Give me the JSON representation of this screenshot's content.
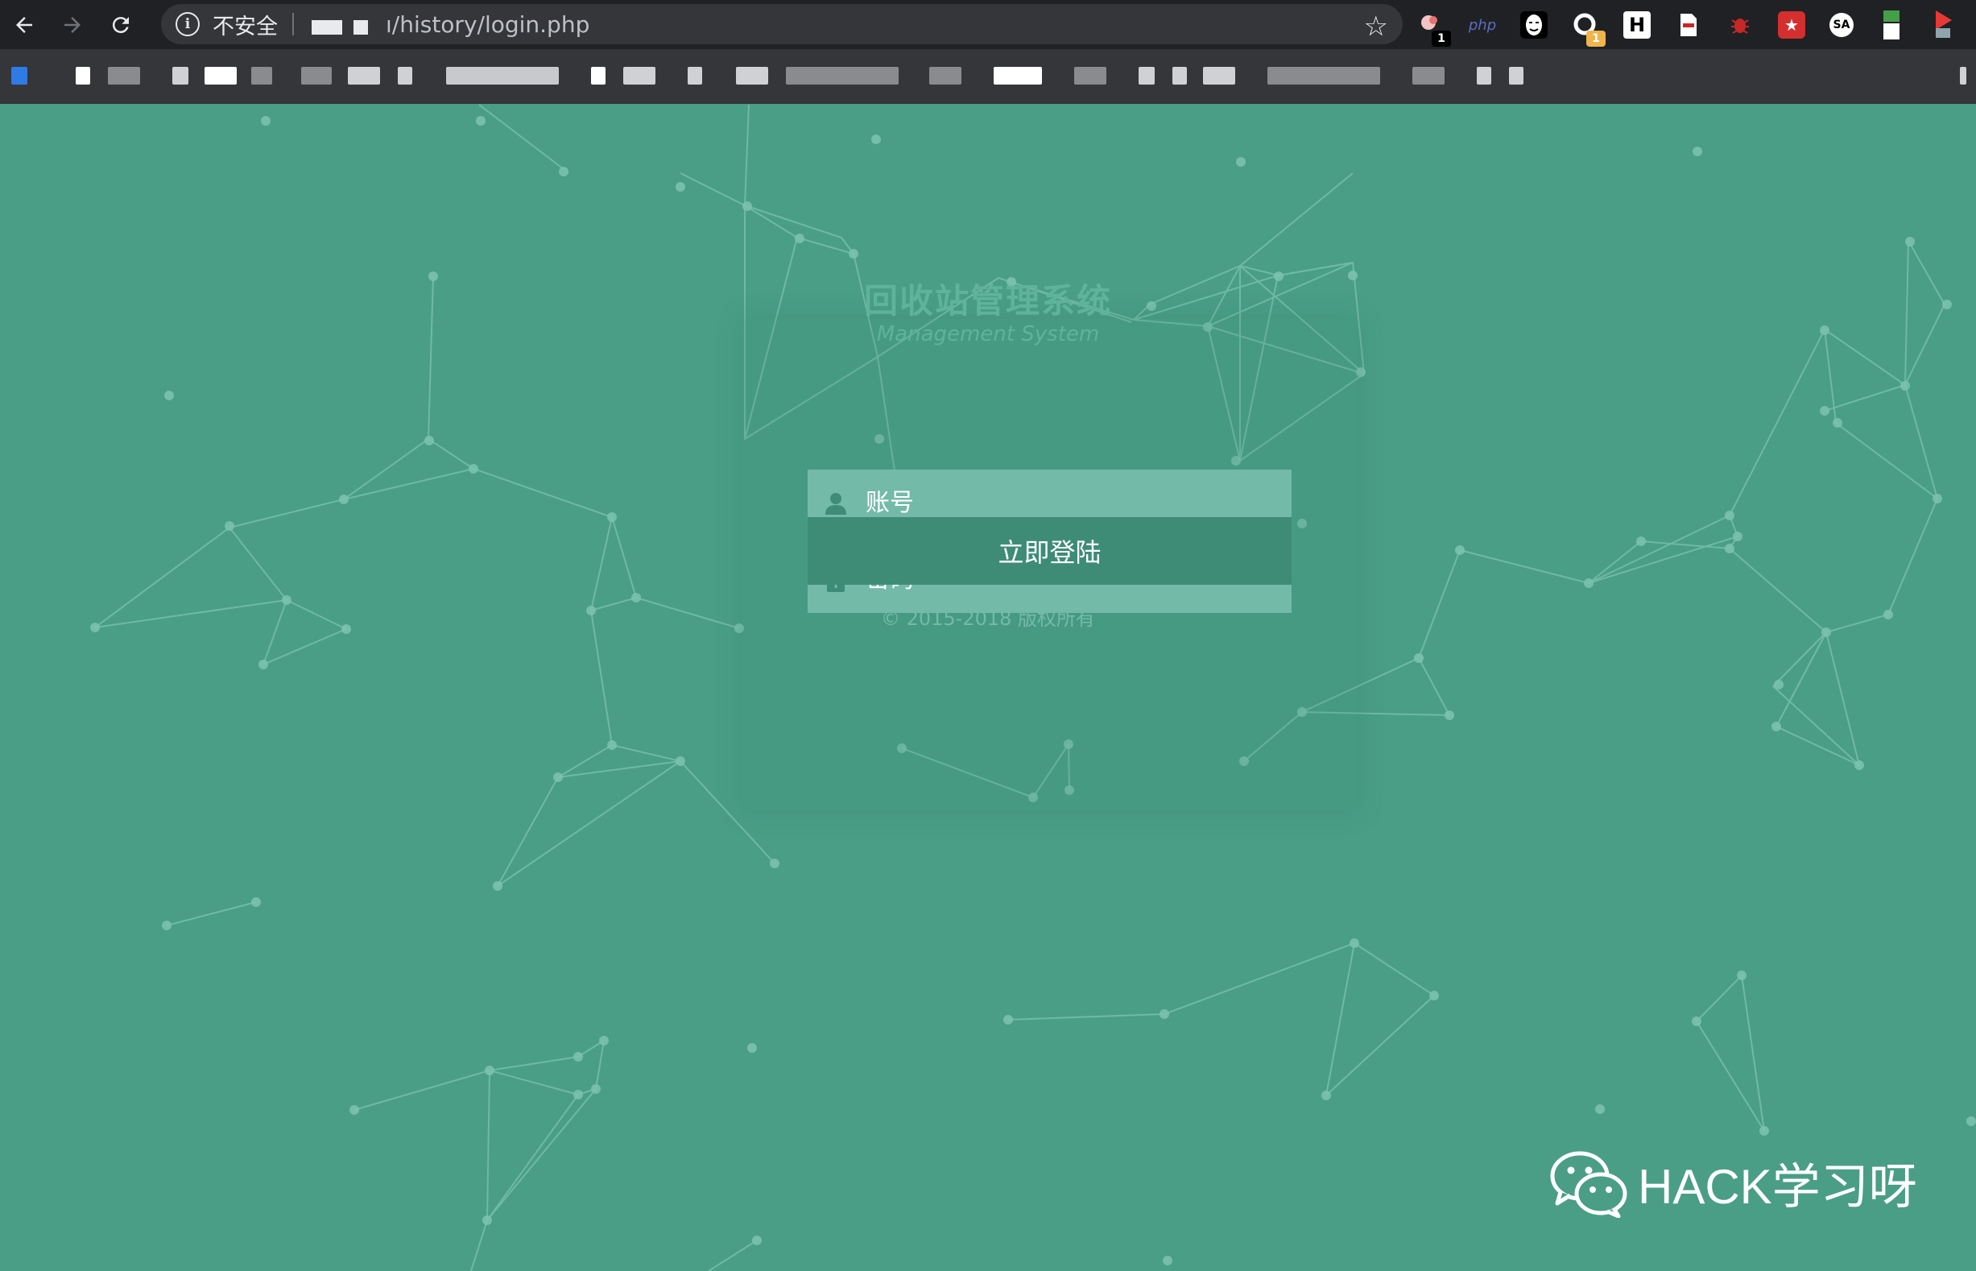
{
  "browser": {
    "security_label": "不安全",
    "url_path": "ı/history/login.php",
    "extensions": [
      {
        "name": "hackbar-extension",
        "badge": "1",
        "color": "#000000"
      },
      {
        "name": "php-extension",
        "label": "php",
        "color": "#5c6bc0"
      },
      {
        "name": "anonymous-extension",
        "color": "#ffffff"
      },
      {
        "name": "proxy-extension",
        "badge": "1",
        "color": "#f0b44c"
      },
      {
        "name": "h-extension",
        "label": "H",
        "color": "#ffffff"
      },
      {
        "name": "cookie-extension",
        "color": "#e8eaed"
      },
      {
        "name": "bug-extension",
        "color": "#c62828"
      },
      {
        "name": "red-extension",
        "color": "#d32f2f"
      },
      {
        "name": "sa-extension",
        "label": "SA",
        "color": "#e8eaed"
      },
      {
        "name": "green-extension",
        "color": "#43a047"
      },
      {
        "name": "profile-extension",
        "color": "#e53935"
      }
    ]
  },
  "login": {
    "title": "回收站管理系统",
    "subtitle": "Management System",
    "username_placeholder": "账号",
    "password_placeholder": "密码",
    "submit_label": "立即登陆",
    "copyright": "© 2015-2018 版权所有"
  },
  "watermark": {
    "text": "HACK学习呀"
  },
  "colors": {
    "background": "#4a9e86",
    "input_bg": "#73baa8",
    "button_bg": "#3e8c76",
    "title": "#5fb39a"
  }
}
